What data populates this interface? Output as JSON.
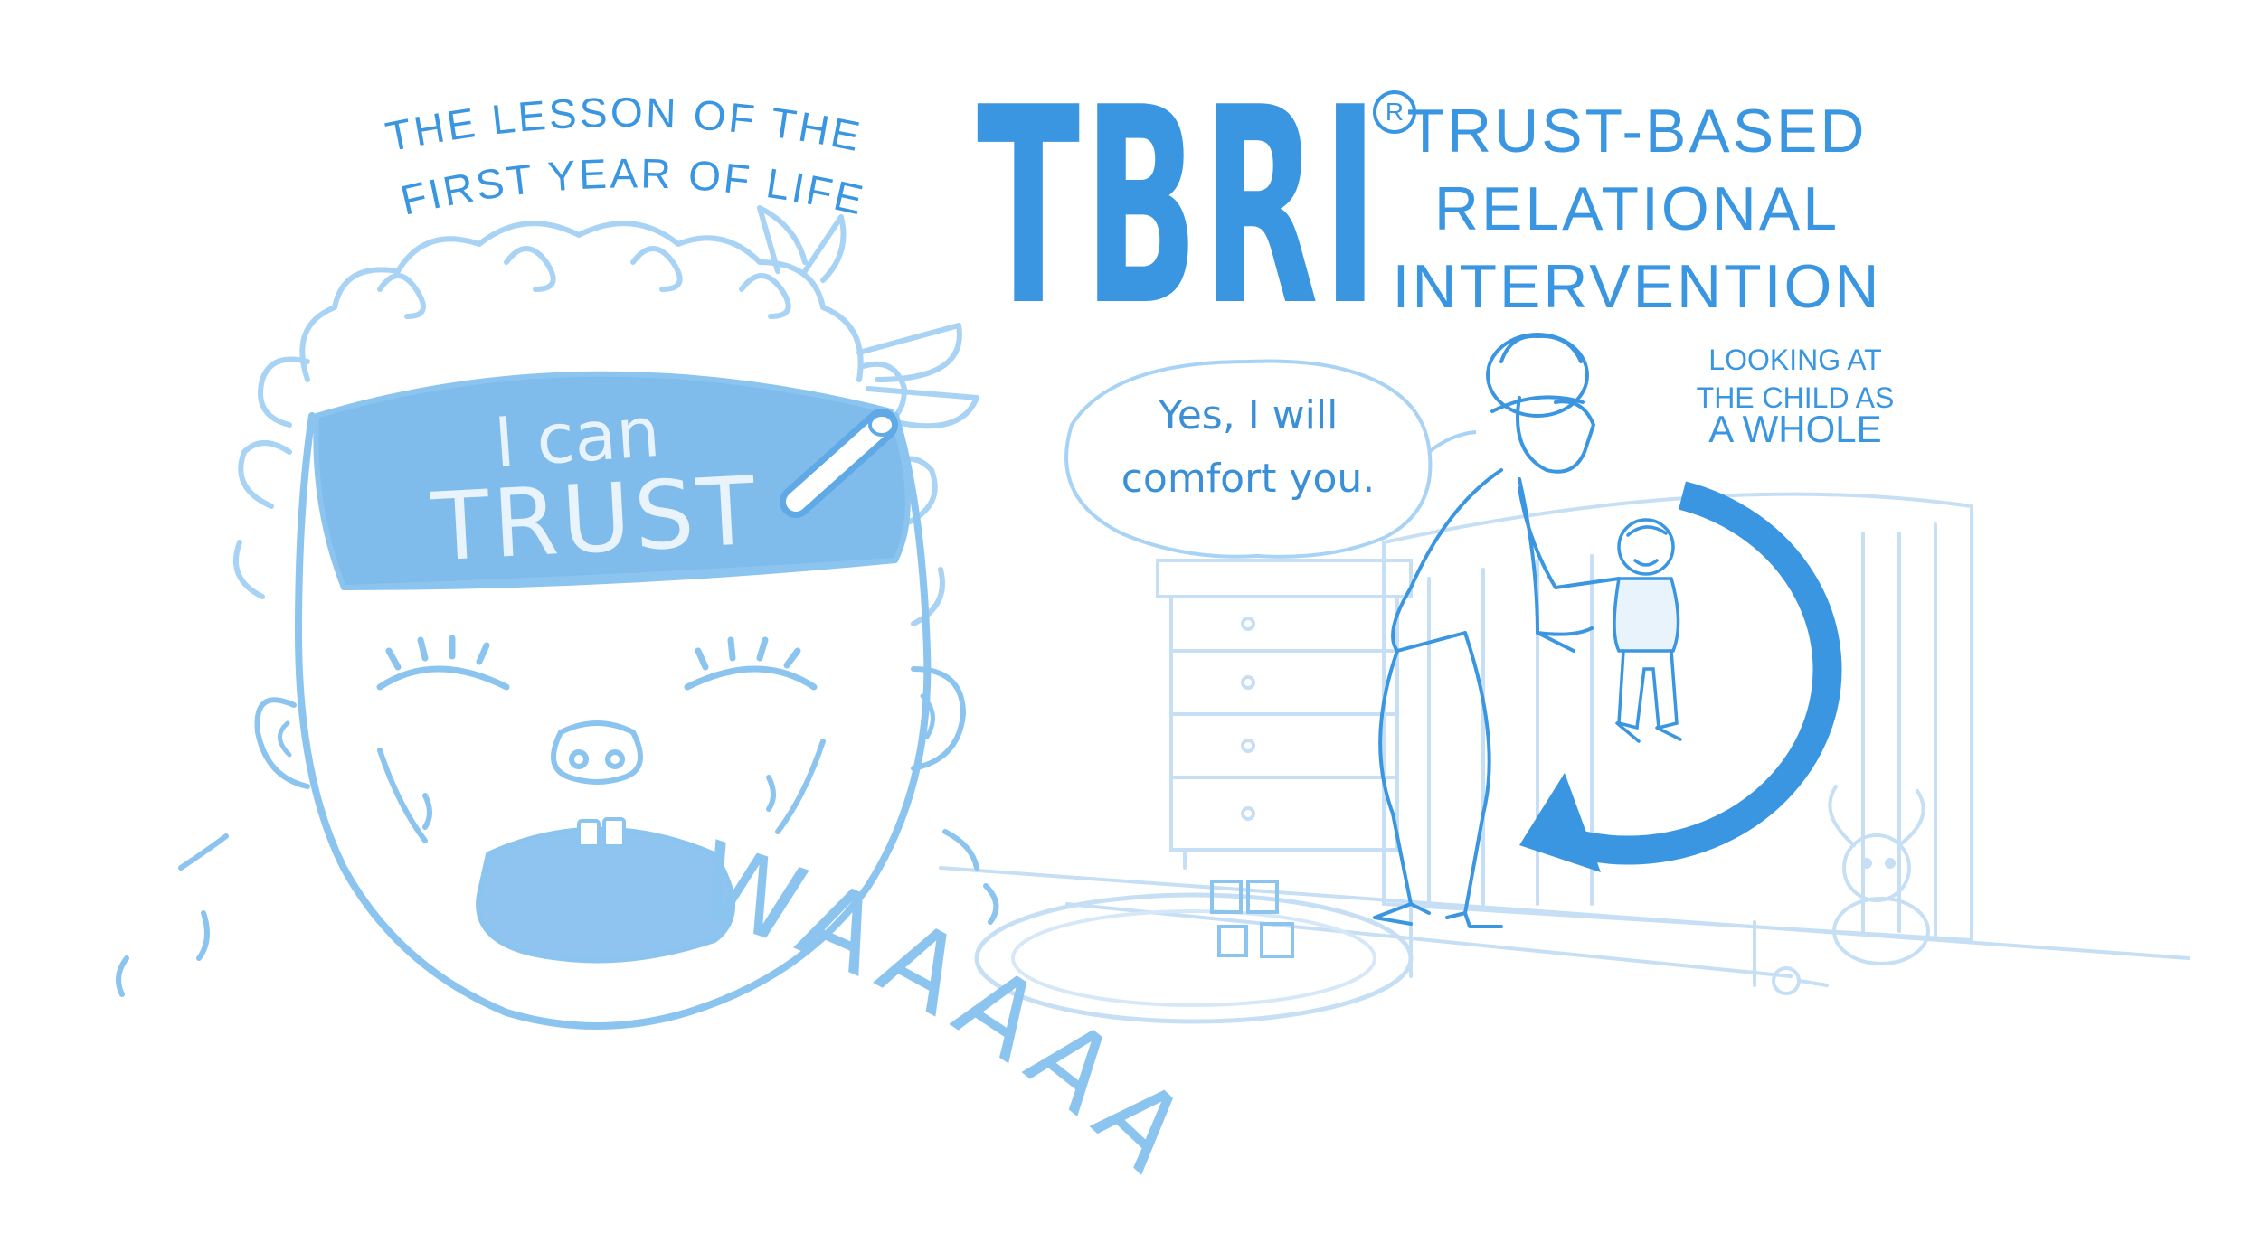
{
  "header": {
    "lesson_line1": "THE LESSON OF THE",
    "lesson_line2": "FIRST YEAR OF LIFE",
    "title": "TBRI",
    "registered_mark": "R",
    "subtitle_line1": "TRUST-BASED",
    "subtitle_line2": "RELATIONAL",
    "subtitle_line3": "INTERVENTION"
  },
  "baby_face": {
    "forehead_line1": "I can",
    "forehead_line2": "TRUST",
    "cry": "WAAAAAH!"
  },
  "nursery": {
    "speech": {
      "line1": "Yes, I will",
      "line2": "comfort you."
    },
    "caption_line1": "LOOKING AT",
    "caption_line2": "THE CHILD AS",
    "caption_line3": "A WHOLE"
  },
  "colors": {
    "brand_blue": "#3a96e0",
    "sketch_blue": "#8cc4f0",
    "light_blue": "#a8d3f5",
    "pale_line": "#c6dff4"
  }
}
